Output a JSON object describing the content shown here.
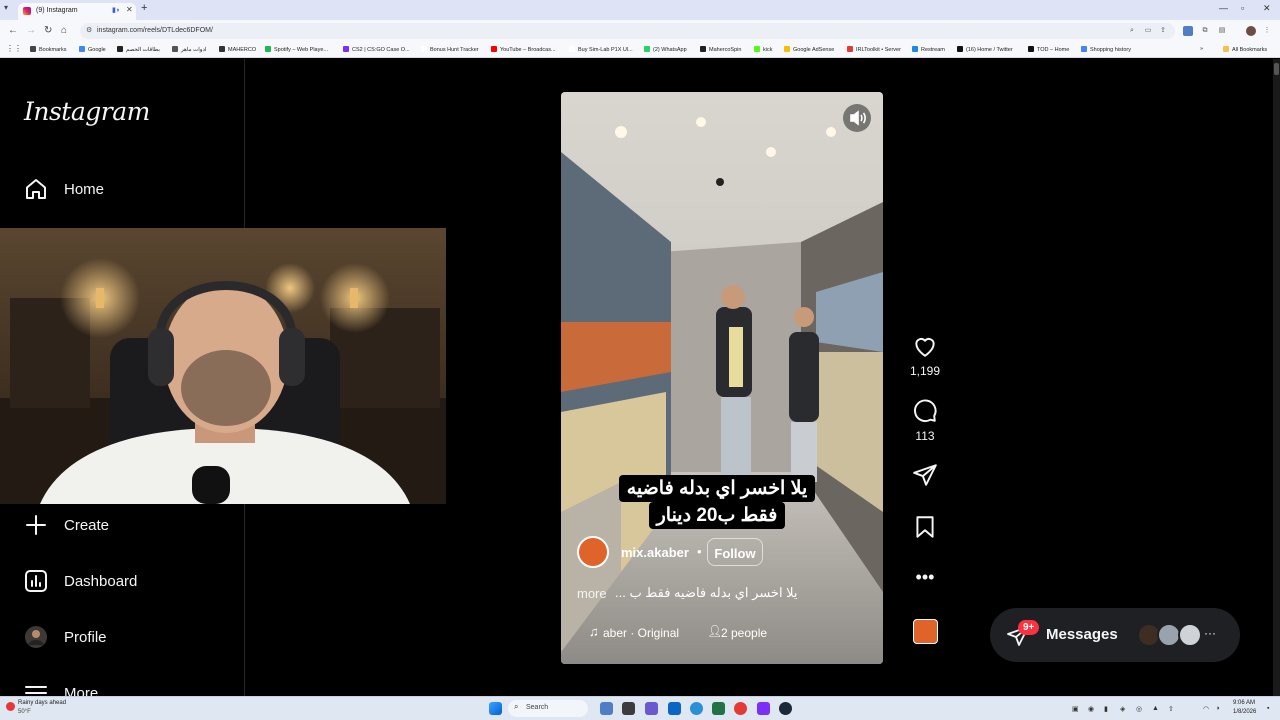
{
  "browser": {
    "tab_title": "(9) Instagram",
    "new_tab": "+",
    "url": "instagram.com/reels/DTLdec6DFOM/",
    "bookmarks": [
      {
        "label": "Bookmarks",
        "color": "#444"
      },
      {
        "label": "Google",
        "color": "#4285f4"
      },
      {
        "label": "بطاقات الخصم",
        "color": "#222"
      },
      {
        "label": "ادوات ماهر",
        "color": "#555"
      },
      {
        "label": "MAHERCO",
        "color": "#333"
      },
      {
        "label": "Spotify – Web Playe...",
        "color": "#1db954"
      },
      {
        "label": "CS2 | CS:GO Case O...",
        "color": "#7b2ff7"
      },
      {
        "label": "Bonus Hunt Tracker",
        "color": "#ffffff"
      },
      {
        "label": "YouTube – Broadcas...",
        "color": "#ff0000"
      },
      {
        "label": "Buy Sim-Lab P1X Ul...",
        "color": "#ffffff"
      },
      {
        "label": "(2) WhatsApp",
        "color": "#25d366"
      },
      {
        "label": "MahercoSpin",
        "color": "#222"
      },
      {
        "label": "kick",
        "color": "#53fc18"
      },
      {
        "label": "Google AdSense",
        "color": "#fbbc04"
      },
      {
        "label": "IRLToolkit • Server",
        "color": "#e53935"
      },
      {
        "label": "Restream",
        "color": "#1e88e5"
      },
      {
        "label": "(16) Home / Twitter",
        "color": "#111"
      },
      {
        "label": "TOD – Home",
        "color": "#111"
      },
      {
        "label": "Shopping history",
        "color": "#4285f4"
      }
    ],
    "all_bookmarks": "All Bookmarks"
  },
  "sidebar": {
    "logo": "Instagram",
    "home": "Home",
    "create": "Create",
    "dashboard": "Dashboard",
    "profile": "Profile",
    "more": "More"
  },
  "reel": {
    "caption_line1": "يلا اخسر اي بدله فاضيه",
    "caption_line2": "فقط ب20 دينار",
    "username": "mix.akaber",
    "follow": "Follow",
    "description": "يلا اخسر اي بدله فاضيه فقط ب ...",
    "more": "more",
    "audio": "aber · Original",
    "people": "2 people"
  },
  "actions": {
    "likes": "1,199",
    "comments": "113"
  },
  "messages": {
    "label": "Messages",
    "badge": "9+"
  },
  "taskbar": {
    "weather_title": "Rainy days ahead",
    "weather_temp": "50°F",
    "search": "Search",
    "time": "9:06 AM",
    "date": "1/8/2026"
  }
}
